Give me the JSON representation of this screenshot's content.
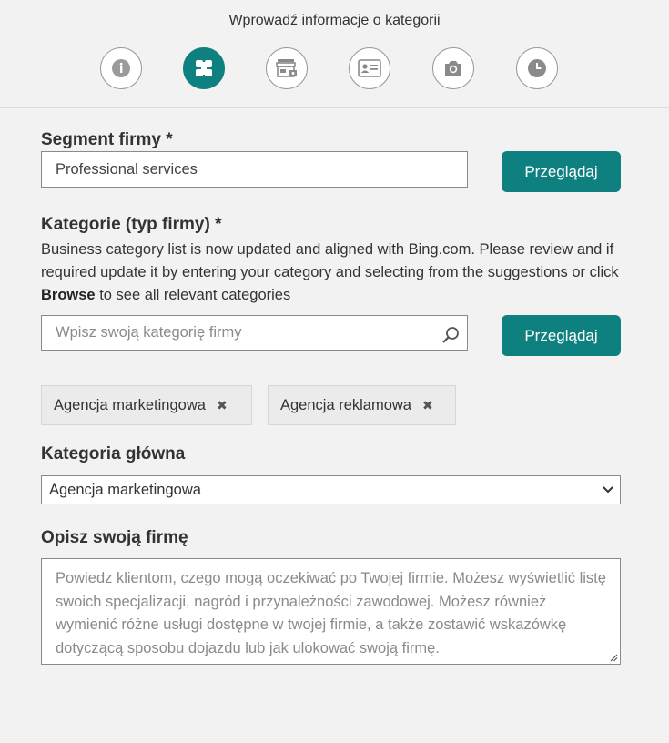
{
  "header": {
    "title": "Wprowadź informacje o kategorii",
    "steps": [
      {
        "icon": "info-icon"
      },
      {
        "icon": "category-icon"
      },
      {
        "icon": "storefront-icon"
      },
      {
        "icon": "contact-card-icon"
      },
      {
        "icon": "camera-icon"
      },
      {
        "icon": "clock-icon"
      }
    ],
    "active_step": 2
  },
  "segment": {
    "label": "Segment firmy *",
    "value": "Professional services",
    "browse_label": "Przeglądaj"
  },
  "categories": {
    "label": "Kategorie (typ firmy) *",
    "description_before": "Business category list is now updated and aligned with Bing.com. Please review and if required update it by entering your category and selecting from the suggestions or click ",
    "description_bold": "Browse",
    "description_after": " to see all relevant categories",
    "search_placeholder": "Wpisz swoją kategorię firmy",
    "browse_label": "Przeglądaj",
    "chips": [
      {
        "label": "Agencja marketingowa",
        "remove": "✖"
      },
      {
        "label": "Agencja reklamowa",
        "remove": "✖"
      }
    ]
  },
  "main_category": {
    "label": "Kategoria główna",
    "selected": "Agencja marketingowa"
  },
  "description": {
    "label": "Opisz swoją firmę",
    "placeholder": "Powiedz klientom, czego mogą oczekiwać po Twojej firmie. Możesz wyświetlić listę swoich specjalizacji, nagród i przynależności zawodowej. Możesz również wymienić różne usługi dostępne w twojej firmie, a także zostawić wskazówkę dotyczącą sposobu dojazdu lub jak ulokować swoją firmę."
  },
  "colors": {
    "accent": "#0e8080",
    "background": "#f2f2f2",
    "border": "#8a8a8a"
  }
}
